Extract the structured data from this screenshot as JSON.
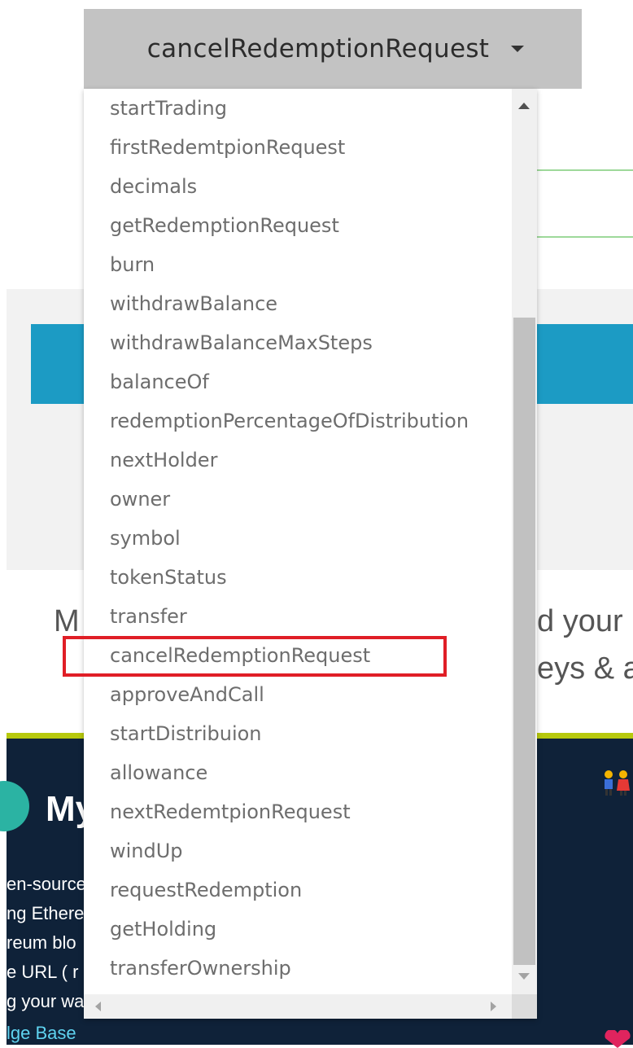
{
  "select": {
    "selected": "cancelRedemptionRequest"
  },
  "dropdown": {
    "options": [
      "startTrading",
      "firstRedemtpionRequest",
      "decimals",
      "getRedemptionRequest",
      "burn",
      "withdrawBalance",
      "withdrawBalanceMaxSteps",
      "balanceOf",
      "redemptionPercentageOfDistribution",
      "nextHolder",
      "owner",
      "symbol",
      "tokenStatus",
      "transfer",
      "cancelRedemptionRequest",
      "approveAndCall",
      "startDistribuion",
      "allowance",
      "nextRedemtpionRequest",
      "windUp",
      "requestRedemption",
      "getHolding",
      "transferOwnership"
    ],
    "highlighted_index": 14
  },
  "background": {
    "partial_left": "M",
    "partial_right_1": "d your",
    "partial_right_2": "eys & a",
    "footer": {
      "title": "My",
      "lines": [
        "en-source",
        "ng Ethere",
        "reum blo",
        "e URL ( r",
        "g your wa"
      ],
      "link": "lge Base"
    }
  },
  "colors": {
    "highlight": "#e01e26",
    "accent_blue": "#1c9bc4",
    "footer_bg": "#0f2239",
    "footer_border": "#b7c90d"
  }
}
